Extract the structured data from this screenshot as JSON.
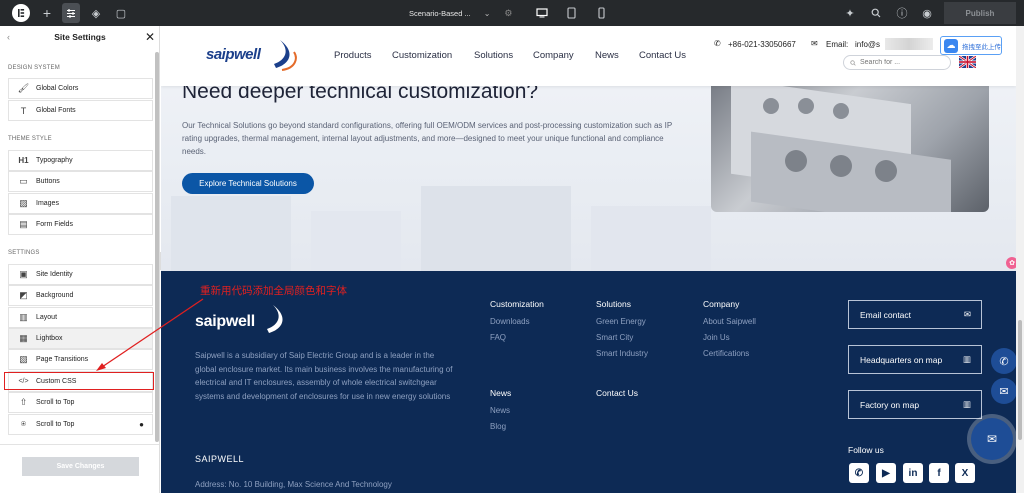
{
  "topbar": {
    "page_title": "Scenario-Based ...",
    "publish_label": "Publish"
  },
  "sidebar": {
    "title": "Site Settings",
    "sections": {
      "design_system": "DESIGN SYSTEM",
      "theme_style": "THEME STYLE",
      "settings": "SETTINGS"
    },
    "design_items": [
      {
        "label": "Global Colors",
        "icon": "brush-icon"
      },
      {
        "label": "Global Fonts",
        "icon": "text-icon"
      }
    ],
    "theme_items": [
      {
        "label": "Typography",
        "icon": "h1-icon"
      },
      {
        "label": "Buttons",
        "icon": "button-icon"
      },
      {
        "label": "Images",
        "icon": "image-icon"
      },
      {
        "label": "Form Fields",
        "icon": "form-icon"
      }
    ],
    "settings_items": [
      {
        "label": "Site Identity",
        "icon": "site-identity-icon"
      },
      {
        "label": "Background",
        "icon": "background-icon"
      },
      {
        "label": "Layout",
        "icon": "layout-icon"
      },
      {
        "label": "Lightbox",
        "icon": "lightbox-icon"
      },
      {
        "label": "Page Transitions",
        "icon": "transition-icon"
      },
      {
        "label": "Custom CSS",
        "icon": "code-icon"
      },
      {
        "label": "Scroll to Top",
        "icon": "arrow-up-icon"
      },
      {
        "label": "Scroll to Top",
        "icon": "scroll-icon"
      }
    ],
    "save_label": "Save Changes"
  },
  "annotation": {
    "text": "重新用代码添加全局颜色和字体",
    "color": "#e02020"
  },
  "site": {
    "header": {
      "logo_text": "saipwell",
      "nav": [
        "Products",
        "Customization",
        "Solutions",
        "Company",
        "News",
        "Contact Us"
      ],
      "phone": "+86-021-33050667",
      "email_label": "Email:",
      "email_value": "info@s",
      "search_placeholder": "Search for ...",
      "upload_badge": "拖拽至此上传"
    },
    "hero": {
      "heading": "Need deeper technical customization?",
      "body": "Our Technical Solutions go beyond standard configurations, offering full OEM/ODM services and post-processing customization such as IP rating upgrades, thermal management, internal layout adjustments, and more—designed to meet your unique functional and compliance needs.",
      "cta": "Explore Technical Solutions"
    },
    "footer": {
      "logo_text": "saipwell",
      "about": "Saipwell is a subsidiary of Saip Electric Group and is a leader in the global enclosure market. Its main business involves the manufacturing of electrical and IT enclosures, assembly of whole electrical switchgear systems and development of enclosures for use in new energy solutions",
      "company_heading": "SAIPWELL",
      "address": "Address: No. 10 Building, Max Science And Technology",
      "columns": {
        "customization": {
          "title": "Customization",
          "links": [
            "Downloads",
            "FAQ"
          ]
        },
        "solutions": {
          "title": "Solutions",
          "links": [
            "Green Energy",
            "Smart City",
            "Smart Industry"
          ]
        },
        "company": {
          "title": "Company",
          "links": [
            "About Saipwell",
            "Join Us",
            "Certifications"
          ]
        },
        "news": {
          "title": "News",
          "links": [
            "News",
            "Blog"
          ]
        },
        "contact": {
          "title": "Contact Us"
        }
      },
      "contact_boxes": [
        {
          "label": "Email contact",
          "icon": "mail-icon"
        },
        {
          "label": "Headquarters on map",
          "icon": "map-icon"
        },
        {
          "label": "Factory on map",
          "icon": "map-icon"
        }
      ],
      "follow_us": "Follow us",
      "social": [
        {
          "icon": "whatsapp-icon",
          "glyph": "✆"
        },
        {
          "icon": "youtube-icon",
          "glyph": "▶"
        },
        {
          "icon": "linkedin-icon",
          "glyph": "in"
        },
        {
          "icon": "facebook-icon",
          "glyph": "f"
        },
        {
          "icon": "x-icon",
          "glyph": "X"
        }
      ]
    }
  },
  "colors": {
    "topbar": "#26292c",
    "footer_bg": "#0d2a55",
    "accent_blue": "#0b56a6",
    "annotation_red": "#e02020"
  }
}
